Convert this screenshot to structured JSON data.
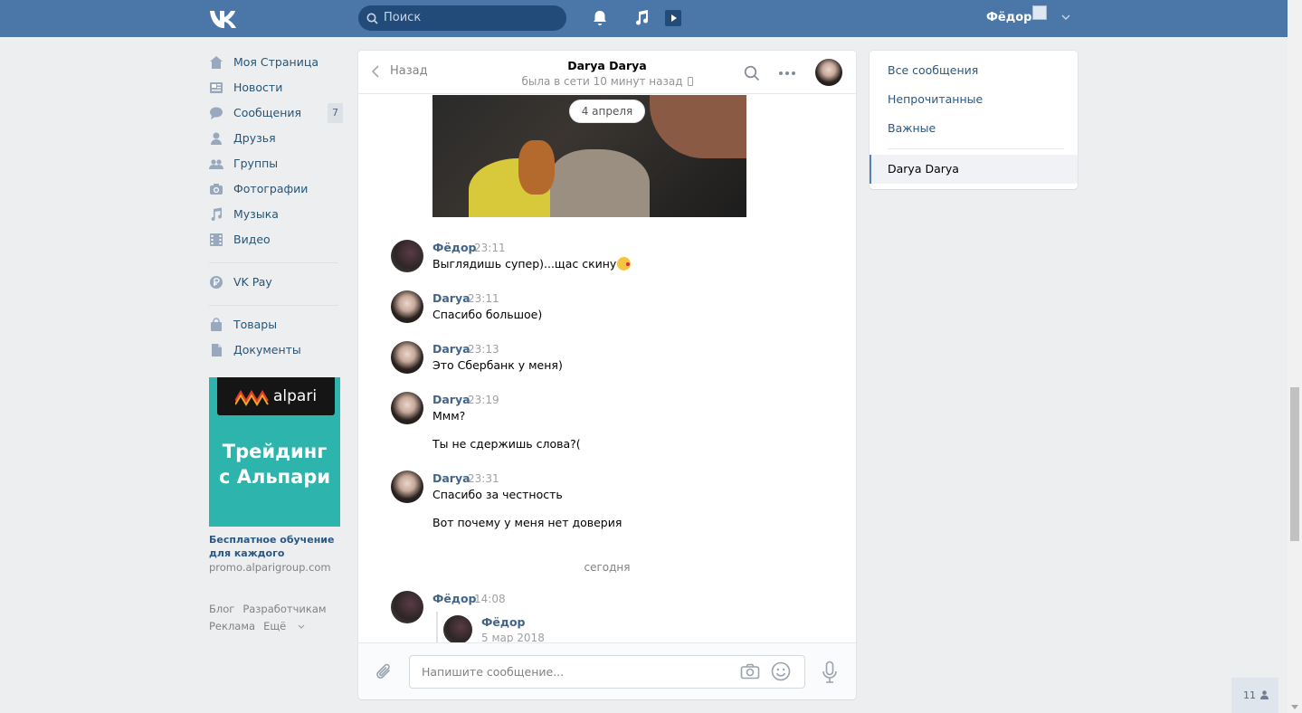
{
  "header": {
    "logo_text": "VK",
    "search_placeholder": "Поиск",
    "user_name": "Фёдор"
  },
  "sidebar": {
    "items": [
      {
        "label": "Моя Страница",
        "icon": "home-icon"
      },
      {
        "label": "Новости",
        "icon": "news-icon"
      },
      {
        "label": "Сообщения",
        "icon": "messages-icon",
        "badge": "7"
      },
      {
        "label": "Друзья",
        "icon": "friends-icon"
      },
      {
        "label": "Группы",
        "icon": "groups-icon"
      },
      {
        "label": "Фотографии",
        "icon": "camera-icon"
      },
      {
        "label": "Музыка",
        "icon": "music-icon"
      },
      {
        "label": "Видео",
        "icon": "video-icon"
      }
    ],
    "pay": {
      "label": "VK Pay",
      "icon": "vkpay-icon"
    },
    "extra": [
      {
        "label": "Товары",
        "icon": "bag-icon"
      },
      {
        "label": "Документы",
        "icon": "document-icon"
      }
    ],
    "ad": {
      "brand": "alpari",
      "headline_1": "Трейдинг",
      "headline_2": "с Альпари",
      "caption": "Бесплатное обучение для каждого",
      "domain": "promo.alparigroup.com"
    },
    "footer": {
      "blog": "Блог",
      "devs": "Разработчикам",
      "ads": "Реклама",
      "more": "Ещё"
    }
  },
  "chat": {
    "back_label": "Назад",
    "peer_name": "Darya Darya",
    "peer_status": "была в сети 10 минут назад",
    "date_pill": "4 апреля",
    "messages": [
      {
        "author": "Фёдор",
        "time": "23:11",
        "lines": [
          "Выглядишь супер)...щас скину"
        ],
        "emoji": true
      },
      {
        "author": "Darya",
        "time": "23:11",
        "lines": [
          "Спасибо большое)"
        ]
      },
      {
        "author": "Darya",
        "time": "23:13",
        "lines": [
          "Это Сбербанк у меня)"
        ]
      },
      {
        "author": "Darya",
        "time": "23:19",
        "lines": [
          "Ммм?",
          "Ты не сдержишь слова?("
        ]
      },
      {
        "author": "Darya",
        "time": "23:31",
        "lines": [
          "Спасибо за честность",
          "Вот почему у меня нет доверия"
        ]
      }
    ],
    "day_separator": "сегодня",
    "last_message": {
      "author": "Фёдор",
      "time": "14:08",
      "forwarded": {
        "author": "Фёдор",
        "date": "5 мар 2018"
      }
    },
    "composer_placeholder": "Напишите сообщение..."
  },
  "right_panel": {
    "filters": [
      "Все сообщения",
      "Непрочитанные",
      "Важные"
    ],
    "active_dialog": "Darya Darya"
  },
  "online_count": "11",
  "colors": {
    "header": "#4a76a8",
    "link": "#2a5885",
    "ad_bg": "#2db5ad"
  }
}
